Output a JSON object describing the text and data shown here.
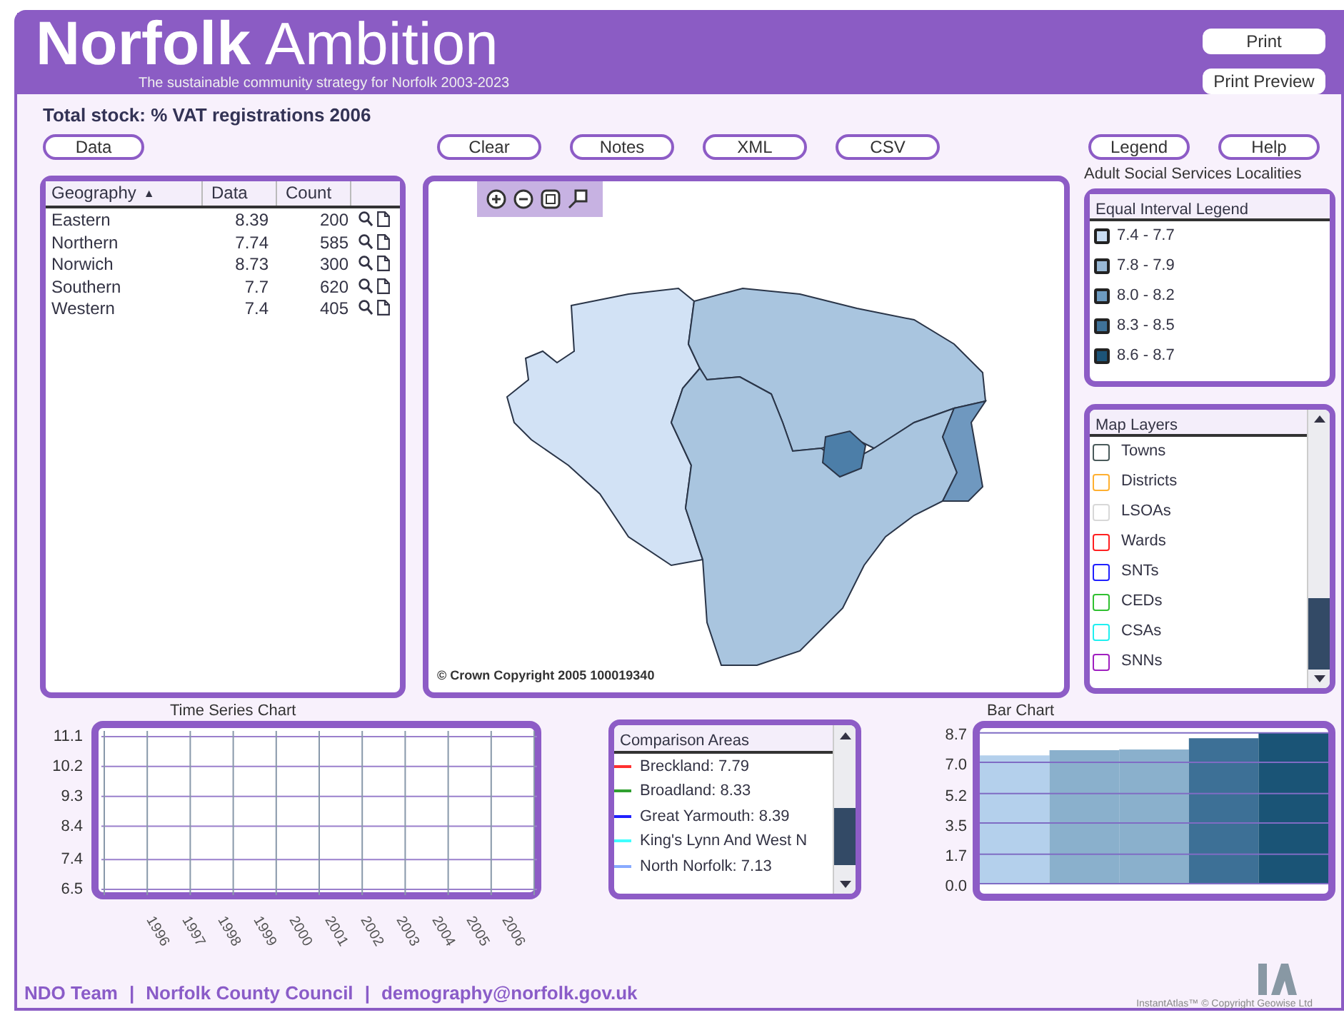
{
  "header": {
    "title_bold": "Norfolk",
    "title_rest": "Ambition",
    "subtitle": "The sustainable community strategy for Norfolk 2003-2023",
    "buttons": [
      "Print",
      "Print Preview"
    ]
  },
  "indicator_title": "Total stock: % VAT registrations 2006",
  "toolbar": {
    "left": [
      "Data"
    ],
    "middle": [
      "Clear",
      "Notes",
      "XML",
      "CSV"
    ],
    "right": [
      "Legend",
      "Help"
    ]
  },
  "theme_label": "Adult Social Services Localities",
  "table": {
    "columns": [
      "Geography",
      "Data",
      "Count"
    ],
    "sort_mark": "▲",
    "rows": [
      {
        "geography": "Eastern",
        "data": "8.39",
        "count": "200"
      },
      {
        "geography": "Northern",
        "data": "7.74",
        "count": "585"
      },
      {
        "geography": "Norwich",
        "data": "8.73",
        "count": "300"
      },
      {
        "geography": "Southern",
        "data": "7.7",
        "count": "620"
      },
      {
        "geography": "Western",
        "data": "7.4",
        "count": "405"
      }
    ]
  },
  "map": {
    "copyright": "© Crown Copyright 2005 100019340",
    "regions": [
      {
        "kind": "western",
        "color": "#d2e2f5"
      },
      {
        "kind": "northern",
        "color": "#a9c5df"
      },
      {
        "kind": "southern",
        "color": "#a9c5df"
      },
      {
        "kind": "eastern",
        "color": "#6f98bf"
      },
      {
        "kind": "norwich",
        "color": "#4c7ea8"
      }
    ]
  },
  "legend": {
    "title": "Equal Interval Legend",
    "items": [
      {
        "label": "7.4 - 7.7",
        "color": "#c9ddf2"
      },
      {
        "label": "7.8 - 7.9",
        "color": "#98b8d4"
      },
      {
        "label": "8.0 - 8.2",
        "color": "#6d9bc0"
      },
      {
        "label": "8.3 - 8.5",
        "color": "#3f7298"
      },
      {
        "label": "8.6 - 8.7",
        "color": "#1c5478"
      }
    ]
  },
  "map_layers": {
    "title": "Map Layers",
    "items": [
      {
        "label": "Towns",
        "color": "#4a5a5a",
        "checked": false
      },
      {
        "label": "Districts",
        "color": "#ffb030",
        "checked": false
      },
      {
        "label": "LSOAs",
        "color": "#d8d8d8",
        "checked": false
      },
      {
        "label": "Wards",
        "color": "#ff2020",
        "checked": false
      },
      {
        "label": "SNTs",
        "color": "#2020ff",
        "checked": false
      },
      {
        "label": "CEDs",
        "color": "#30c030",
        "checked": false
      },
      {
        "label": "CSAs",
        "color": "#20f0f0",
        "checked": false
      },
      {
        "label": "SNNs",
        "color": "#a020c0",
        "checked": false
      }
    ]
  },
  "time_series": {
    "title": "Time Series Chart",
    "chart_data": {
      "type": "line",
      "categories": [
        "1996",
        "1997",
        "1998",
        "1999",
        "2000",
        "2001",
        "2002",
        "2003",
        "2004",
        "2005",
        "2006"
      ],
      "ylim": [
        6.5,
        11.1
      ],
      "yticks": [
        6.5,
        7.4,
        8.4,
        9.3,
        10.2,
        11.1
      ],
      "grid": true
    }
  },
  "comparison": {
    "title": "Comparison Areas",
    "items": [
      {
        "label": "Breckland: 7.79",
        "color": "#ff3030"
      },
      {
        "label": "Broadland: 8.33",
        "color": "#30a030"
      },
      {
        "label": "Great Yarmouth: 8.39",
        "color": "#2020ff"
      },
      {
        "label": "King's Lynn And West N",
        "color": "#40ffff"
      },
      {
        "label": "North Norfolk: 7.13",
        "color": "#88aaff"
      }
    ]
  },
  "bar_chart": {
    "title": "Bar Chart",
    "chart_data": {
      "type": "bar",
      "values": [
        7.4,
        7.7,
        7.74,
        8.39,
        8.73
      ],
      "ylim": [
        0,
        8.73
      ],
      "yticks": [
        {
          "value": 0,
          "label": "0.0"
        },
        1.7,
        3.5,
        5.2,
        {
          "value": 7.0,
          "label": "7.0"
        },
        8.7
      ],
      "grid": true
    },
    "bars": [
      {
        "color": "#b4d0ec"
      },
      {
        "color": "#8ab0cc"
      },
      {
        "color": "#8ab0cc"
      },
      {
        "color": "#3d7096"
      },
      {
        "color": "#1a5476"
      }
    ]
  },
  "footer": {
    "links": [
      "NDO Team",
      "Norfolk County Council",
      "demography@norfolk.gov.uk"
    ],
    "separator": "|",
    "credit": "InstantAtlas™ © Copyright Geowise Ltd"
  }
}
